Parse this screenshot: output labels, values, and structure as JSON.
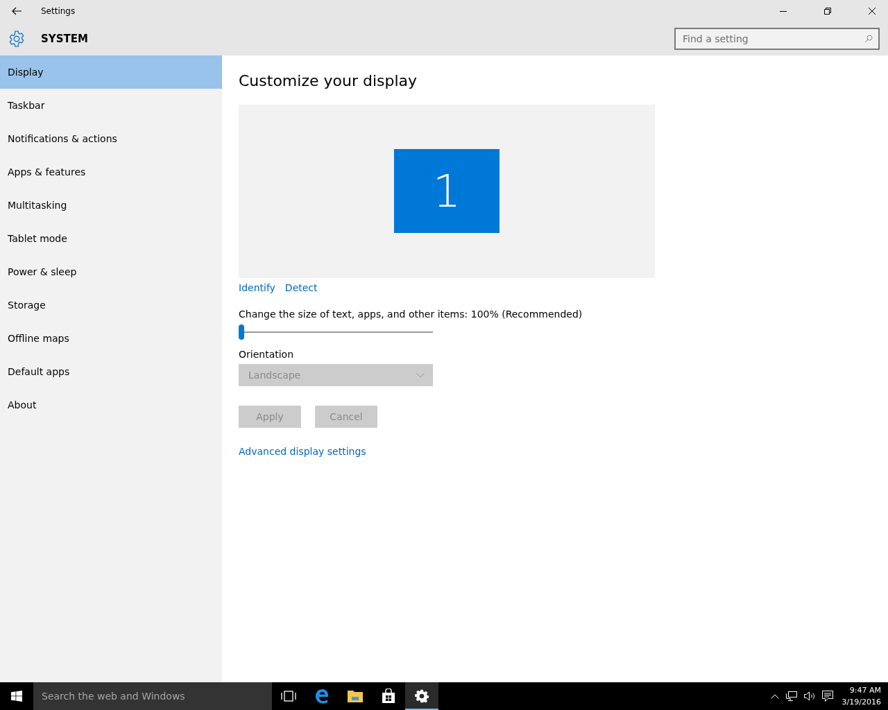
{
  "window": {
    "title": "Settings"
  },
  "header": {
    "title": "SYSTEM",
    "search": {
      "placeholder": "Find a setting"
    }
  },
  "sidebar": {
    "items": [
      {
        "label": "Display",
        "selected": true
      },
      {
        "label": "Taskbar",
        "selected": false
      },
      {
        "label": "Notifications & actions",
        "selected": false
      },
      {
        "label": "Apps & features",
        "selected": false
      },
      {
        "label": "Multitasking",
        "selected": false
      },
      {
        "label": "Tablet mode",
        "selected": false
      },
      {
        "label": "Power & sleep",
        "selected": false
      },
      {
        "label": "Storage",
        "selected": false
      },
      {
        "label": "Offline maps",
        "selected": false
      },
      {
        "label": "Default apps",
        "selected": false
      },
      {
        "label": "About",
        "selected": false
      }
    ]
  },
  "content": {
    "heading": "Customize your display",
    "monitor": {
      "label": "1"
    },
    "links": [
      "Identify",
      "Detect"
    ],
    "scale": {
      "label": "Change the size of text, apps, and other items: 100% (Recommended)",
      "level": 0
    },
    "orientation": {
      "label": "Orientation",
      "value": "Landscape",
      "disabled": true
    },
    "buttons": [
      {
        "label": "Apply",
        "disabled": true
      },
      {
        "label": "Cancel",
        "disabled": true
      }
    ],
    "advanced_link": "Advanced display settings"
  },
  "taskbar": {
    "search": {
      "placeholder": "Search the web and Windows"
    },
    "apps": [
      {
        "kind": "taskview",
        "selected": false
      },
      {
        "kind": "edge",
        "selected": false
      },
      {
        "kind": "explorer",
        "selected": false
      },
      {
        "kind": "store",
        "selected": false
      },
      {
        "kind": "settings",
        "selected": true
      }
    ],
    "time": "9:47 AM",
    "date": "3/19/2016"
  }
}
